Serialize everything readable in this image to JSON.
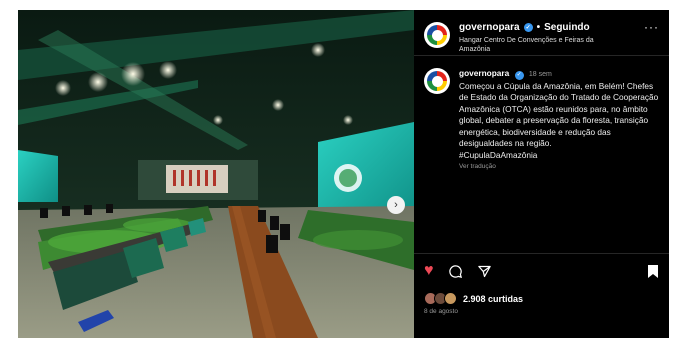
{
  "header": {
    "username": "governopara",
    "separator": "•",
    "follow_status": "Seguindo",
    "location": "Hangar Centro De Convenções e Feiras da Amazônia",
    "more": "···"
  },
  "caption": {
    "username": "governopara",
    "time": "18 sem",
    "text": "Começou a Cúpula da Amazônia, em Belém! Chefes de Estado da Organização do Tratado de Cooperação Amazônica (OTCA) estão reunidos para, no âmbito global, debater a preservação da floresta, transição energética, biodiversidade e redução das desigualdades na região.",
    "hashtag": "#CupulaDaAmazônia",
    "translate": "Ver tradução"
  },
  "footer": {
    "likes": "2.908 curtidas",
    "date": "8 de agosto"
  },
  "icons": {
    "like": "heart-icon",
    "comment": "comment-icon",
    "share": "share-icon",
    "save": "bookmark-icon",
    "next": "chevron-right-icon"
  },
  "colors": {
    "like": "#ed4956",
    "verified": "#3897f0",
    "background": "#000000"
  }
}
